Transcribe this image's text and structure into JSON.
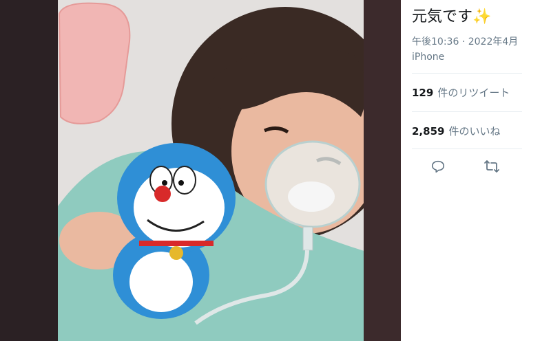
{
  "tweet": {
    "text": "元気です",
    "emoji": "✨",
    "time": "午後10:36",
    "date": "2022年4月",
    "source": "iPhone"
  },
  "stats": {
    "retweets_count": "129",
    "retweets_label": "件のリツイート",
    "likes_count": "2,859",
    "likes_label": "件のいいね"
  },
  "actions": {
    "reply_icon": "reply-icon",
    "retweet_icon": "retweet-icon"
  },
  "colors": {
    "text_primary": "#14171a",
    "text_secondary": "#657786",
    "divider": "#e6ecf0",
    "background_dark": "#2a2022"
  }
}
